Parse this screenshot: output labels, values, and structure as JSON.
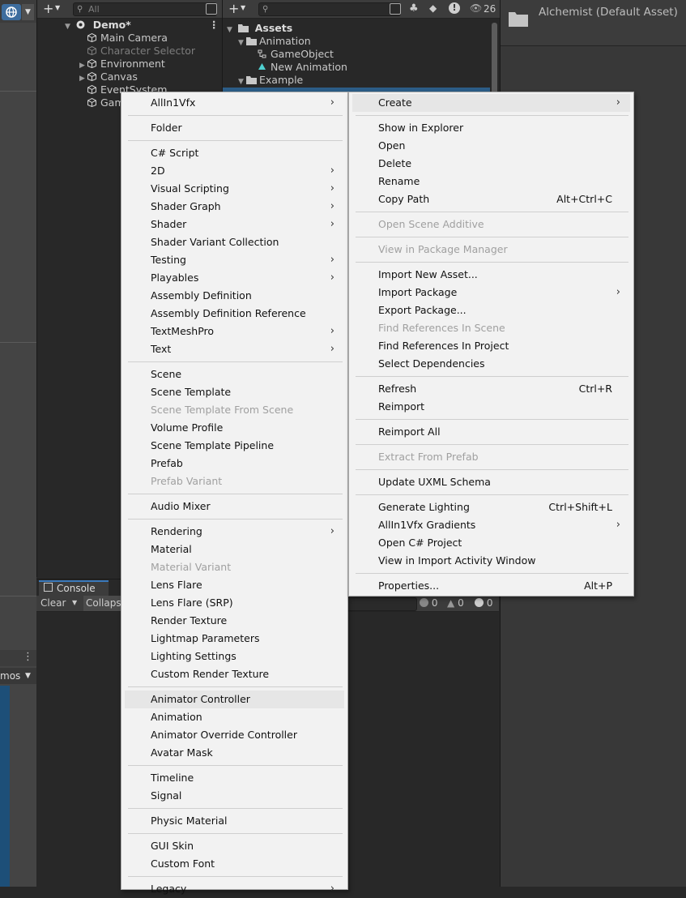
{
  "hierarchy": {
    "search_placeholder": "All",
    "scene_name": "Demo*",
    "items": [
      {
        "label": "Main Camera",
        "dim": false,
        "arrow": false
      },
      {
        "label": "Character Selector",
        "dim": true,
        "arrow": false
      },
      {
        "label": "Environment",
        "dim": false,
        "arrow": true
      },
      {
        "label": "Canvas",
        "dim": false,
        "arrow": true
      },
      {
        "label": "EventSystem",
        "dim": false,
        "arrow": false
      },
      {
        "label": "Gam",
        "dim": false,
        "arrow": false
      }
    ]
  },
  "project": {
    "count_badge": "26",
    "root": "Assets",
    "tree": [
      {
        "label": "Animation",
        "level": 1,
        "kind": "folder-open"
      },
      {
        "label": "GameObject",
        "level": 2,
        "kind": "anim-controller"
      },
      {
        "label": "New Animation",
        "level": 2,
        "kind": "anim-clip"
      },
      {
        "label": "Example",
        "level": 1,
        "kind": "folder-open"
      }
    ]
  },
  "inspector": {
    "title": "Alchemist (Default Asset)"
  },
  "console": {
    "tab_label": "Console",
    "clear_label": "Clear",
    "collapse_label": "Collaps",
    "error_count": "0",
    "warning_count": "0",
    "log_count": "0"
  },
  "scene": {
    "gizmos_label": "mos"
  },
  "left_menu": {
    "items": [
      {
        "label": "AllIn1Vfx",
        "sub": true
      },
      {
        "sep": true
      },
      {
        "label": "Folder"
      },
      {
        "sep": true
      },
      {
        "label": "C# Script"
      },
      {
        "label": "2D",
        "sub": true
      },
      {
        "label": "Visual Scripting",
        "sub": true
      },
      {
        "label": "Shader Graph",
        "sub": true
      },
      {
        "label": "Shader",
        "sub": true
      },
      {
        "label": "Shader Variant Collection"
      },
      {
        "label": "Testing",
        "sub": true
      },
      {
        "label": "Playables",
        "sub": true
      },
      {
        "label": "Assembly Definition"
      },
      {
        "label": "Assembly Definition Reference"
      },
      {
        "label": "TextMeshPro",
        "sub": true
      },
      {
        "label": "Text",
        "sub": true
      },
      {
        "sep": true
      },
      {
        "label": "Scene"
      },
      {
        "label": "Scene Template"
      },
      {
        "label": "Scene Template From Scene",
        "disabled": true
      },
      {
        "label": "Volume Profile"
      },
      {
        "label": "Scene Template Pipeline"
      },
      {
        "label": "Prefab"
      },
      {
        "label": "Prefab Variant",
        "disabled": true
      },
      {
        "sep": true
      },
      {
        "label": "Audio Mixer"
      },
      {
        "sep": true
      },
      {
        "label": "Rendering",
        "sub": true
      },
      {
        "label": "Material"
      },
      {
        "label": "Material Variant",
        "disabled": true
      },
      {
        "label": "Lens Flare"
      },
      {
        "label": "Lens Flare (SRP)"
      },
      {
        "label": "Render Texture"
      },
      {
        "label": "Lightmap Parameters"
      },
      {
        "label": "Lighting Settings"
      },
      {
        "label": "Custom Render Texture"
      },
      {
        "sep": true
      },
      {
        "label": "Animator Controller",
        "highlight": true
      },
      {
        "label": "Animation"
      },
      {
        "label": "Animator Override Controller"
      },
      {
        "label": "Avatar Mask"
      },
      {
        "sep": true
      },
      {
        "label": "Timeline"
      },
      {
        "label": "Signal"
      },
      {
        "sep": true
      },
      {
        "label": "Physic Material"
      },
      {
        "sep": true
      },
      {
        "label": "GUI Skin"
      },
      {
        "label": "Custom Font"
      },
      {
        "sep": true
      },
      {
        "label": "Legacy",
        "sub": true
      }
    ]
  },
  "right_menu": {
    "items": [
      {
        "label": "Create",
        "sub": true,
        "highlight": true
      },
      {
        "sep": true
      },
      {
        "label": "Show in Explorer"
      },
      {
        "label": "Open"
      },
      {
        "label": "Delete"
      },
      {
        "label": "Rename"
      },
      {
        "label": "Copy Path",
        "shortcut": "Alt+Ctrl+C"
      },
      {
        "sep": true
      },
      {
        "label": "Open Scene Additive",
        "disabled": true
      },
      {
        "sep": true
      },
      {
        "label": "View in Package Manager",
        "disabled": true
      },
      {
        "sep": true
      },
      {
        "label": "Import New Asset..."
      },
      {
        "label": "Import Package",
        "sub": true
      },
      {
        "label": "Export Package..."
      },
      {
        "label": "Find References In Scene",
        "disabled": true
      },
      {
        "label": "Find References In Project"
      },
      {
        "label": "Select Dependencies"
      },
      {
        "sep": true
      },
      {
        "label": "Refresh",
        "shortcut": "Ctrl+R"
      },
      {
        "label": "Reimport"
      },
      {
        "sep": true
      },
      {
        "label": "Reimport All"
      },
      {
        "sep": true
      },
      {
        "label": "Extract From Prefab",
        "disabled": true
      },
      {
        "sep": true
      },
      {
        "label": "Update UXML Schema"
      },
      {
        "sep": true
      },
      {
        "label": "Generate Lighting",
        "shortcut": "Ctrl+Shift+L"
      },
      {
        "label": "AllIn1Vfx Gradients",
        "sub": true
      },
      {
        "label": "Open C# Project"
      },
      {
        "label": "View in Import Activity Window"
      },
      {
        "sep": true
      },
      {
        "label": "Properties...",
        "shortcut": "Alt+P"
      }
    ]
  }
}
